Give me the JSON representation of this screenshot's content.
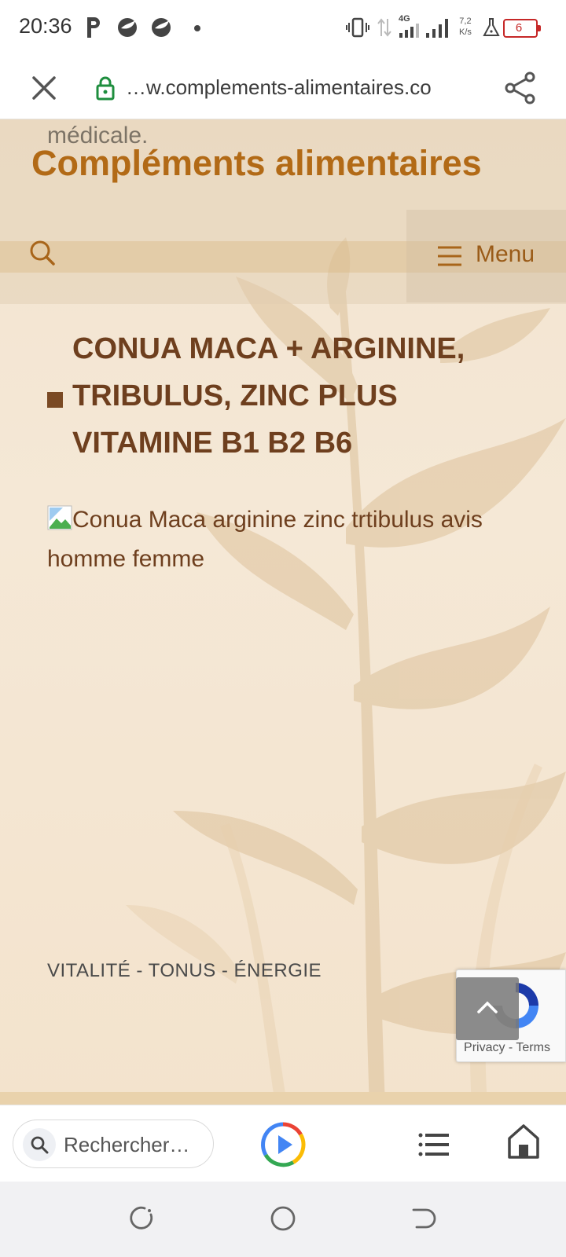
{
  "status_bar": {
    "time": "20:36",
    "network_type": "4G",
    "net_speed_value": "7,2",
    "net_speed_unit": "K/s",
    "battery_level": "6",
    "icons": [
      "parking-icon",
      "bird-app-icon",
      "bird-app-icon",
      "notification-dot-icon",
      "vibrate-icon",
      "data-arrows-icon",
      "signal-bars-icon",
      "signal-bars-icon",
      "flask-icon",
      "battery-icon"
    ]
  },
  "browser": {
    "url": "…w.complements-alimentaires.co",
    "close_icon": "close-icon",
    "lock_icon": "lock-icon",
    "share_icon": "share-icon"
  },
  "page": {
    "cut_text": "médicale.",
    "site_title": "Compléments alimentaires",
    "menu_label": "Menu",
    "product_title_lines": [
      "CONUA MACA + ARGININE,",
      "TRIBULUS, ZINC PLUS",
      "VITAMINE B1 B2 B6"
    ],
    "image_alt": "Conua Maca arginine zinc trtibulus avis homme femme",
    "tagline": "VITALITÉ - TONUS - ÉNERGIE",
    "recaptcha": {
      "privacy": "Privacy",
      "separator": "-",
      "terms": "Terms"
    },
    "colors": {
      "title": "#b26a16",
      "heading": "#6e3f1e",
      "background": "#f3e4cf"
    }
  },
  "toolbar": {
    "search_placeholder": "Rechercher…",
    "icons": [
      "search-icon",
      "play-icon",
      "list-icon",
      "home-icon"
    ]
  },
  "android_nav": {
    "icons": [
      "recent-apps-icon",
      "home-circle-icon",
      "back-icon"
    ]
  }
}
